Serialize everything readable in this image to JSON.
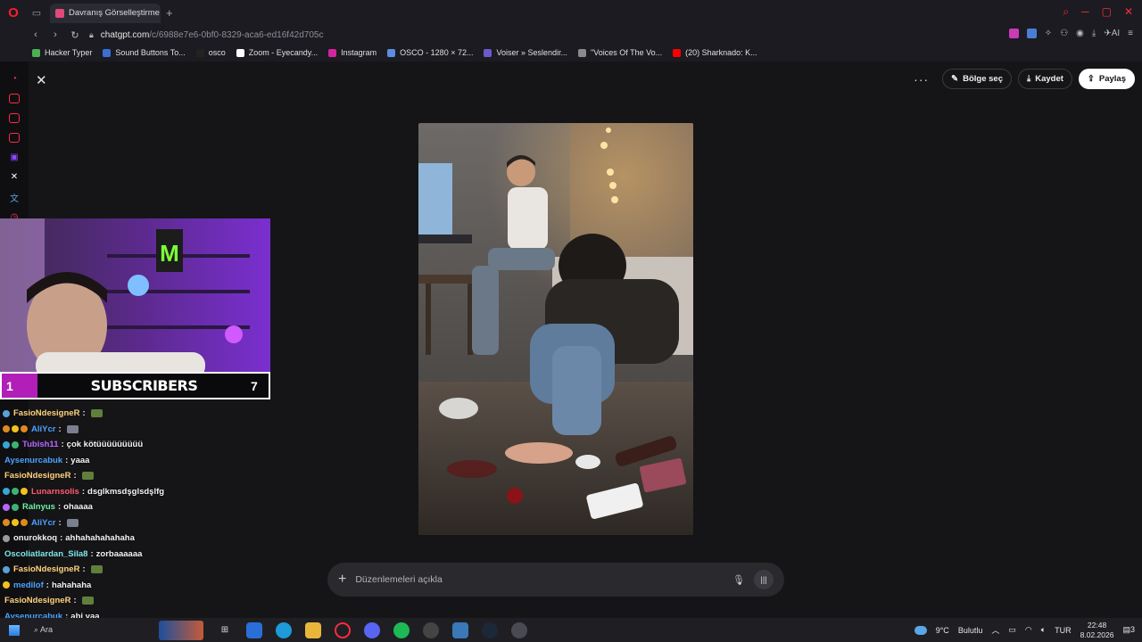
{
  "browser": {
    "tab_title": "Davranış Görselleştirme Ta",
    "url_host": "chatgpt.com",
    "url_path": "/c/6988e7e6-0bf0-8329-aca6-ed16f42d705c",
    "ai_label": "AI"
  },
  "bookmarks": [
    {
      "label": "Hacker Typer",
      "color": "#4caf50"
    },
    {
      "label": "Sound Buttons To...",
      "color": "#3a6fd8"
    },
    {
      "label": "osco",
      "color": "#222222"
    },
    {
      "label": "Zoom - Eyecandy...",
      "color": "#ffffff"
    },
    {
      "label": "Instagram",
      "color": "#d6249f"
    },
    {
      "label": "OSCO - 1280 × 72...",
      "color": "#5b8de0"
    },
    {
      "label": "Voiser » Seslendir...",
      "color": "#6a5acd"
    },
    {
      "label": "\"Voices Of The Vo...",
      "color": "#8a8a8a"
    },
    {
      "label": "(20) Sharknado: K...",
      "color": "#ff0000"
    }
  ],
  "actions": {
    "region": "Bölge seç",
    "save": "Kaydet",
    "share": "Paylaş"
  },
  "composer": {
    "placeholder": "Düzenlemeleri açıkla"
  },
  "overlay": {
    "sub_left": "1",
    "sub_label": "SUBSCRIBERS",
    "sub_right": "7"
  },
  "chat": [
    {
      "user": "FasioNdesigneR",
      "color": "#ffd27a",
      "text": "",
      "emote": "frog",
      "badges": [
        "#5aa0d8"
      ]
    },
    {
      "user": "AliYcr",
      "color": "#4aa3ff",
      "text": "",
      "emote": "cat",
      "badges": [
        "#e08a1e",
        "#f2c21b",
        "#e08a1e"
      ]
    },
    {
      "user": "Tubish11",
      "color": "#b865ff",
      "text": "çok kötüüüüüüüüü",
      "emote": "",
      "badges": [
        "#33a8d9",
        "#3cb371"
      ]
    },
    {
      "user": "Aysenurcabuk",
      "color": "#4aa3ff",
      "text": "yaaa",
      "emote": "",
      "badges": []
    },
    {
      "user": "FasioNdesigneR",
      "color": "#ffd27a",
      "text": "",
      "emote": "frog",
      "badges": []
    },
    {
      "user": "Lunarnsolis",
      "color": "#ff5a6e",
      "text": "dsglkmsdşglsdşlfg",
      "emote": "",
      "badges": [
        "#33a8d9",
        "#3cb371",
        "#f2c21b"
      ]
    },
    {
      "user": "Ralnyus",
      "color": "#6ff0a0",
      "text": "ohaaaa",
      "emote": "",
      "badges": [
        "#b865ff",
        "#3cb371"
      ]
    },
    {
      "user": "AliYcr",
      "color": "#4aa3ff",
      "text": "",
      "emote": "cat",
      "badges": [
        "#e08a1e",
        "#f2c21b",
        "#e08a1e"
      ]
    },
    {
      "user": "onurokkoq",
      "color": "#f0f0f0",
      "text": "ahhahahahahaha",
      "emote": "",
      "badges": [
        "#9a9aa0"
      ]
    },
    {
      "user": "Oscoliatlardan_Sila8",
      "color": "#7fe7e7",
      "text": "zorbaaaaaa",
      "emote": "",
      "badges": []
    },
    {
      "user": "FasioNdesigneR",
      "color": "#ffd27a",
      "text": "",
      "emote": "frog",
      "badges": [
        "#5aa0d8"
      ]
    },
    {
      "user": "medilof",
      "color": "#4aa3ff",
      "text": "hahahaha",
      "emote": "",
      "badges": [
        "#f2c21b"
      ]
    },
    {
      "user": "FasioNdesigneR",
      "color": "#ffd27a",
      "text": "",
      "emote": "frog",
      "badges": []
    },
    {
      "user": "Aysenurcabuk",
      "color": "#4aa3ff",
      "text": "abi yaa",
      "emote": "",
      "badges": []
    }
  ],
  "taskbar": {
    "search": "Ara",
    "weather_temp": "9°C",
    "weather_desc": "Bulutlu",
    "lang": "TUR",
    "time": "22:48",
    "date": "8.02.2026",
    "notif": "3"
  }
}
